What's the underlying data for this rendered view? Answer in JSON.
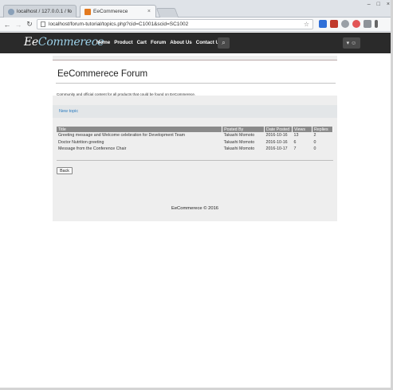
{
  "browser": {
    "tabs": [
      {
        "label": "localhost / 127.0.0.1 / fo"
      },
      {
        "label": "EeCommerece"
      }
    ],
    "address": "localhost/forum-tutorial/topics.php?cid=C1001&scid=SC1002"
  },
  "site": {
    "logo_prefix": "Ee",
    "logo_suffix": "Commerece",
    "nav": [
      "Home",
      "Product",
      "Cart",
      "Forum",
      "About Us",
      "Contact Us"
    ],
    "user_menu_caret": "▾"
  },
  "forum": {
    "title": "EeCommerece Forum",
    "description": "Community and official content for all products that could be found on EeCommerece.",
    "new_topic": "New topic",
    "columns": [
      "Title",
      "Posted By",
      "Date Posted",
      "Views",
      "Replies"
    ],
    "rows": [
      [
        "Greeting message and Welcome celebration for Development Team",
        "Takashi Momoto",
        "2016-10-16",
        "13",
        "2"
      ],
      [
        "Doctor Nutrition greeting",
        "Takashi Momoto",
        "2016-10-16",
        "6",
        "0"
      ],
      [
        "Message from the Conference Chair",
        "Takashi Momoto",
        "2016-10-17",
        "7",
        "0"
      ]
    ],
    "back_label": "Back",
    "footer": "EeCommerece © 2016"
  }
}
